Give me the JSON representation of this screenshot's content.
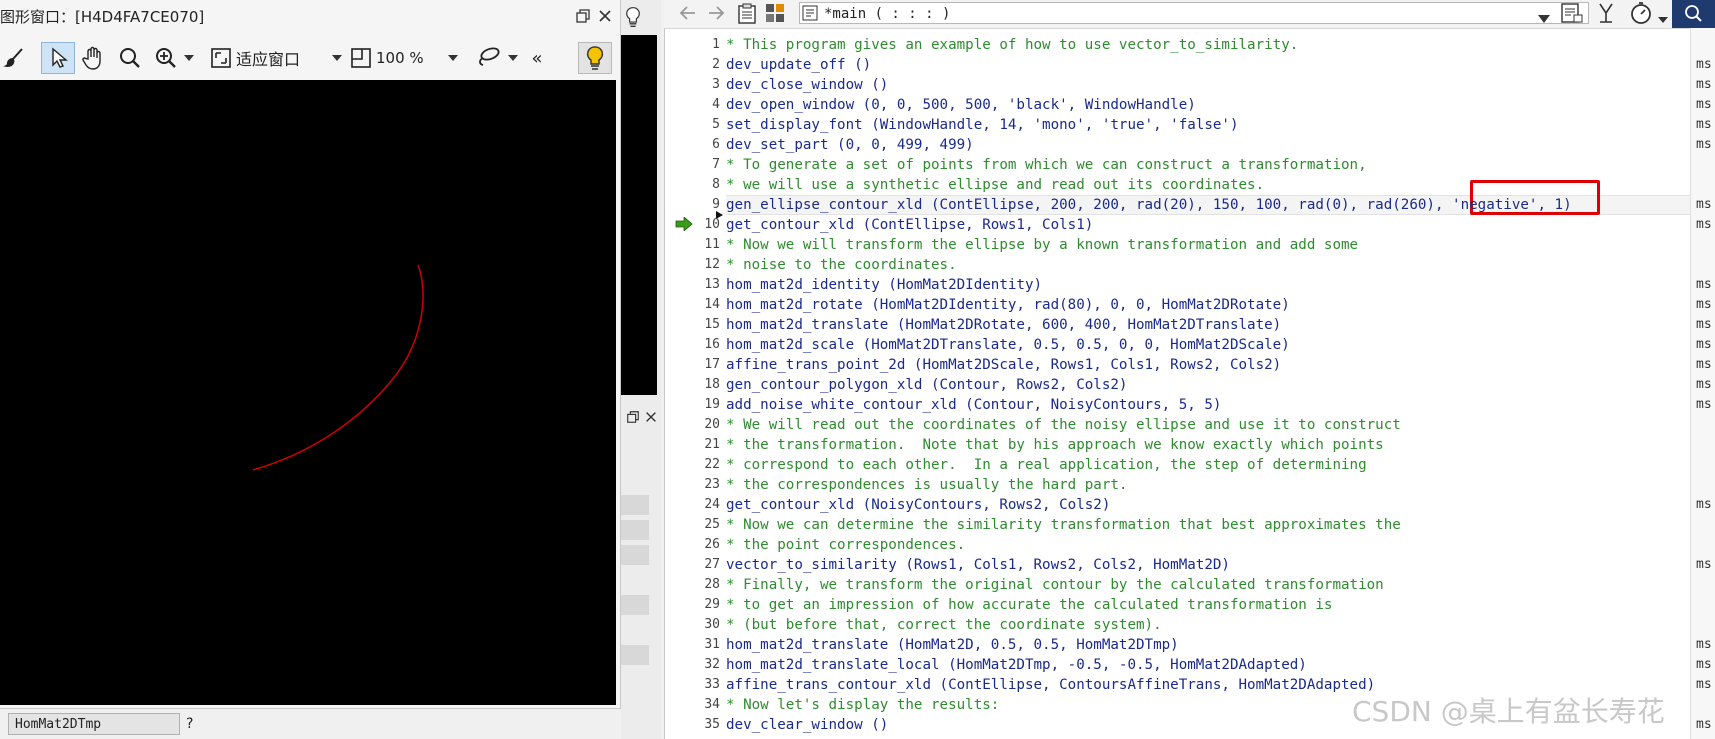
{
  "graphics_window": {
    "title": "图形窗口：[H4D4FA7CE070]",
    "toolbar": {
      "fit_label": "适应窗口",
      "zoom_value": "100 %",
      "collapse_label": "«"
    }
  },
  "variable_row": {
    "name": "HomMat2DTmp",
    "value": "?"
  },
  "editor": {
    "procedure_selector": "*main ( : : : )",
    "time_unit": "ms",
    "lines": [
      {
        "n": "1",
        "text": "* This program gives an example of how to use vector_to_similarity.",
        "kind": "comment",
        "ms": false
      },
      {
        "n": "2",
        "text": "dev_update_off ()",
        "kind": "op",
        "ms": true
      },
      {
        "n": "3",
        "text": "dev_close_window ()",
        "kind": "op",
        "ms": true
      },
      {
        "n": "4",
        "text": "dev_open_window (0, 0, 500, 500, 'black', WindowHandle)",
        "kind": "op",
        "ms": true
      },
      {
        "n": "5",
        "text": "set_display_font (WindowHandle, 14, 'mono', 'true', 'false')",
        "kind": "op",
        "ms": true
      },
      {
        "n": "6",
        "text": "dev_set_part (0, 0, 499, 499)",
        "kind": "op",
        "ms": true
      },
      {
        "n": "7",
        "text": "* To generate a set of points from which we can construct a transformation,",
        "kind": "comment",
        "ms": false
      },
      {
        "n": "8",
        "text": "* we will use a synthetic ellipse and read out its coordinates.",
        "kind": "comment",
        "ms": false
      },
      {
        "n": "9",
        "text": "gen_ellipse_contour_xld (ContEllipse, 200, 200, rad(20), 150, 100, rad(0), rad(260), 'negative', 1)",
        "kind": "op",
        "ms": true
      },
      {
        "n": "10",
        "text": "get_contour_xld (ContEllipse, Rows1, Cols1)",
        "kind": "op",
        "ms": true
      },
      {
        "n": "11",
        "text": "* Now we will transform the ellipse by a known transformation and add some",
        "kind": "comment",
        "ms": false
      },
      {
        "n": "12",
        "text": "* noise to the coordinates.",
        "kind": "comment",
        "ms": false
      },
      {
        "n": "13",
        "text": "hom_mat2d_identity (HomMat2DIdentity)",
        "kind": "op",
        "ms": true
      },
      {
        "n": "14",
        "text": "hom_mat2d_rotate (HomMat2DIdentity, rad(80), 0, 0, HomMat2DRotate)",
        "kind": "op",
        "ms": true
      },
      {
        "n": "15",
        "text": "hom_mat2d_translate (HomMat2DRotate, 600, 400, HomMat2DTranslate)",
        "kind": "op",
        "ms": true
      },
      {
        "n": "16",
        "text": "hom_mat2d_scale (HomMat2DTranslate, 0.5, 0.5, 0, 0, HomMat2DScale)",
        "kind": "op",
        "ms": true
      },
      {
        "n": "17",
        "text": "affine_trans_point_2d (HomMat2DScale, Rows1, Cols1, Rows2, Cols2)",
        "kind": "op",
        "ms": true
      },
      {
        "n": "18",
        "text": "gen_contour_polygon_xld (Contour, Rows2, Cols2)",
        "kind": "op",
        "ms": true
      },
      {
        "n": "19",
        "text": "add_noise_white_contour_xld (Contour, NoisyContours, 5, 5)",
        "kind": "op",
        "ms": true
      },
      {
        "n": "20",
        "text": "* We will read out the coordinates of the noisy ellipse and use it to construct",
        "kind": "comment",
        "ms": false
      },
      {
        "n": "21",
        "text": "* the transformation.  Note that by his approach we know exactly which points",
        "kind": "comment",
        "ms": false
      },
      {
        "n": "22",
        "text": "* correspond to each other.  In a real application, the step of determining",
        "kind": "comment",
        "ms": false
      },
      {
        "n": "23",
        "text": "* the correspondences is usually the hard part.",
        "kind": "comment",
        "ms": false
      },
      {
        "n": "24",
        "text": "get_contour_xld (NoisyContours, Rows2, Cols2)",
        "kind": "op",
        "ms": true
      },
      {
        "n": "25",
        "text": "* Now we can determine the similarity transformation that best approximates the",
        "kind": "comment",
        "ms": false
      },
      {
        "n": "26",
        "text": "* the point correspondences.",
        "kind": "comment",
        "ms": false
      },
      {
        "n": "27",
        "text": "vector_to_similarity (Rows1, Cols1, Rows2, Cols2, HomMat2D)",
        "kind": "op",
        "ms": true
      },
      {
        "n": "28",
        "text": "* Finally, we transform the original contour by the calculated transformation",
        "kind": "comment",
        "ms": false
      },
      {
        "n": "29",
        "text": "* to get an impression of how accurate the calculated transformation is",
        "kind": "comment",
        "ms": false
      },
      {
        "n": "30",
        "text": "* (but before that, correct the coordinate system).",
        "kind": "comment",
        "ms": false
      },
      {
        "n": "31",
        "text": "hom_mat2d_translate (HomMat2D, 0.5, 0.5, HomMat2DTmp)",
        "kind": "op",
        "ms": true
      },
      {
        "n": "32",
        "text": "hom_mat2d_translate_local (HomMat2DTmp, -0.5, -0.5, HomMat2DAdapted)",
        "kind": "op",
        "ms": true
      },
      {
        "n": "33",
        "text": "affine_trans_contour_xld (ContEllipse, ContoursAffineTrans, HomMat2DAdapted)",
        "kind": "op",
        "ms": true
      },
      {
        "n": "34",
        "text": "* Now let's display the results:",
        "kind": "comment",
        "ms": false
      },
      {
        "n": "35",
        "text": "dev_clear_window ()",
        "kind": "op",
        "ms": true
      }
    ]
  },
  "watermark": "CSDN @桌上有盆长寿花",
  "colors": {
    "comment": "#2e8b2e",
    "operator": "#1a2a8a",
    "highlight_box": "#e00000",
    "contour": "#d00000",
    "canvas": "#000000"
  },
  "icons": [
    "brush-icon",
    "pointer-icon",
    "hand-icon",
    "magnifier-icon",
    "zoom-in-icon",
    "fit-window-icon",
    "zoom-icon",
    "lasso-icon",
    "lightbulb-icon",
    "back-icon",
    "forward-icon",
    "clipboard-icon",
    "grid-icon",
    "procedure-icon",
    "timer-icon",
    "run-arrow-icon"
  ]
}
